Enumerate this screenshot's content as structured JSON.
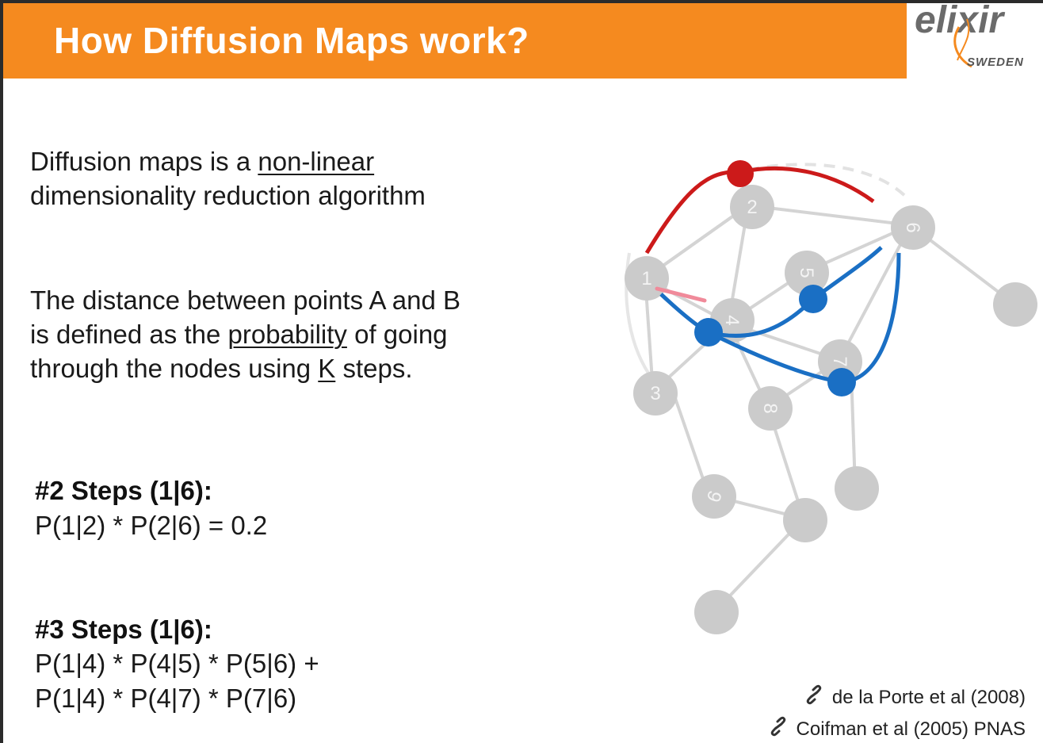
{
  "header": {
    "title": "How Diffusion Maps work?",
    "logo_main": "elixir",
    "logo_sub": "SWEDEN"
  },
  "intro": {
    "line1_pre": "Diffusion maps is a ",
    "line1_underlined": "non-linear",
    "line2": "dimensionality reduction algorithm"
  },
  "definition": {
    "line1": "The distance between points A and B",
    "line2_pre": "is defined as the ",
    "line2_underlined": "probability",
    "line2_post": " of going",
    "line3_pre": "through the nodes using ",
    "line3_underlined": "K",
    "line3_post": " steps."
  },
  "steps2": {
    "heading": "#2 Steps (1|6):",
    "formula": "P(1|2) * P(2|6) =  0.2"
  },
  "steps3": {
    "heading": "#3 Steps (1|6):",
    "formula1": "P(1|4) * P(4|5) * P(5|6) +",
    "formula2": "P(1|4) * P(4|7) * P(7|6)"
  },
  "graph": {
    "nodes": [
      "1",
      "2",
      "3",
      "4",
      "5",
      "6",
      "7",
      "8",
      "9"
    ],
    "colors": {
      "node": "#c8c8c8",
      "edge": "#d2d2d2",
      "red_path": "#cc1a1a",
      "blue_path": "#1a6fc4"
    }
  },
  "references": [
    {
      "text": "de la Porte et al (2008)",
      "icon": "link-icon"
    },
    {
      "text": "Coifman et al (2005) PNAS",
      "icon": "link-icon"
    }
  ]
}
